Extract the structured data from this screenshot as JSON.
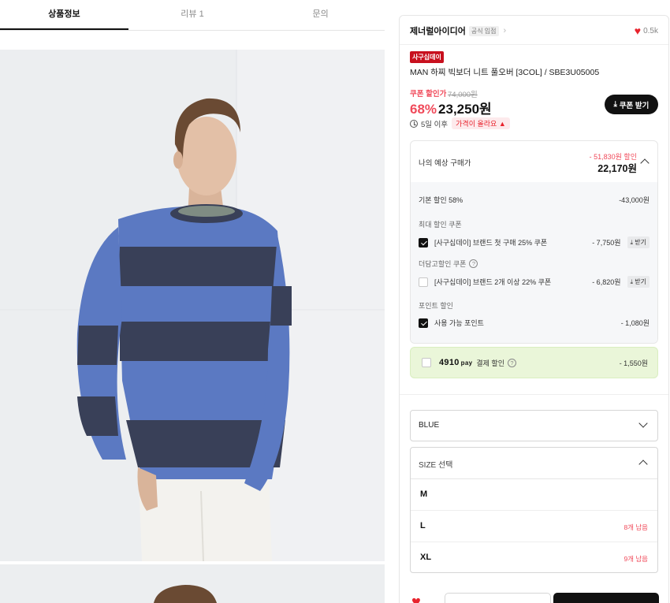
{
  "tabs": [
    {
      "label": "상품정보",
      "active": true
    },
    {
      "label": "리뷰 1",
      "active": false
    },
    {
      "label": "문의",
      "active": false
    }
  ],
  "brand": {
    "name": "제너럴아이디어",
    "badge": "공식 입점",
    "likes": "0.5k"
  },
  "product": {
    "event_badge": "사구십데이",
    "name": "MAN 하찌 빅보더 니트 풀오버 [3COL] / SBE3U05005"
  },
  "price": {
    "coupon_label": "쿠폰 할인가",
    "original": "74,000원",
    "discount_rate": "68%",
    "sale": "23,250원",
    "coupon_button": "쿠폰 받기",
    "notice_days": "5일 이후",
    "notice_badge": "가격이 올라요 ▲"
  },
  "estimate": {
    "label": "나의 예상 구매가",
    "save": "- 51,830원 할인",
    "total": "22,170원",
    "base_discount": {
      "label": "기본 할인 58%",
      "value": "-43,000원"
    },
    "max_coupon_title": "최대 할인 쿠폰",
    "max_coupon": {
      "label": "[사구십데이] 브랜드 첫 구매 25% 쿠폰",
      "value": "- 7,750원",
      "get": "받기",
      "checked": true
    },
    "extra_coupon_title": "더담고할인 쿠폰",
    "extra_coupon": {
      "label": "[사구십데이] 브랜드 2개 이상 22% 쿠폰",
      "value": "- 6,820원",
      "get": "받기",
      "checked": false
    },
    "point_title": "포인트 할인",
    "point": {
      "label": "사용 가능 포인트",
      "value": "- 1,080원",
      "checked": true
    }
  },
  "pay": {
    "logo": "4910",
    "logo_suffix": "pay",
    "label": "결제 할인",
    "value": "- 1,550원"
  },
  "options": {
    "color_selected": "BLUE",
    "size_placeholder": "SIZE 선택",
    "sizes": [
      {
        "label": "M",
        "stock": ""
      },
      {
        "label": "L",
        "stock": "8개 남음"
      },
      {
        "label": "XL",
        "stock": "9개 남음"
      }
    ]
  },
  "colors": {
    "accent_red": "#f04a5a",
    "heart_red": "#e8232d",
    "pay_bg": "#eaf6d9",
    "dark": "#111111"
  },
  "icons": [
    "heart-icon",
    "chevron-right-icon",
    "download-icon",
    "clock-icon",
    "chevron-up-icon",
    "chevron-down-icon",
    "help-icon",
    "check-icon"
  ]
}
